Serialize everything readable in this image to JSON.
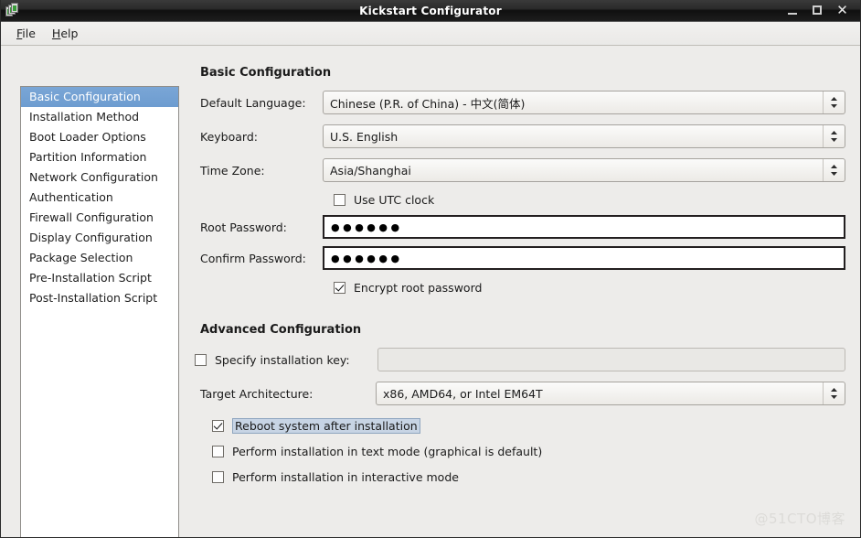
{
  "window": {
    "title": "Kickstart Configurator",
    "icon": "kickstart-app-icon",
    "minimize_label": "—",
    "maximize_label": "□",
    "close_label": "✕"
  },
  "menubar": {
    "items": [
      {
        "label": "File",
        "mnemonic": "F",
        "rest": "ile"
      },
      {
        "label": "Help",
        "mnemonic": "H",
        "rest": "elp"
      }
    ]
  },
  "sidebar": {
    "items": [
      {
        "label": "Basic Configuration",
        "selected": true
      },
      {
        "label": "Installation Method",
        "selected": false
      },
      {
        "label": "Boot Loader Options",
        "selected": false
      },
      {
        "label": "Partition Information",
        "selected": false
      },
      {
        "label": "Network Configuration",
        "selected": false
      },
      {
        "label": "Authentication",
        "selected": false
      },
      {
        "label": "Firewall Configuration",
        "selected": false
      },
      {
        "label": "Display Configuration",
        "selected": false
      },
      {
        "label": "Package Selection",
        "selected": false
      },
      {
        "label": "Pre-Installation Script",
        "selected": false
      },
      {
        "label": "Post-Installation Script",
        "selected": false
      }
    ]
  },
  "basic": {
    "heading": "Basic Configuration",
    "default_language_label": "Default Language:",
    "default_language_value": "Chinese (P.R. of China) - 中文(简体)",
    "keyboard_label": "Keyboard:",
    "keyboard_value": "U.S. English",
    "time_zone_label": "Time Zone:",
    "time_zone_value": "Asia/Shanghai",
    "use_utc_label": "Use UTC clock",
    "use_utc_checked": false,
    "root_password_label": "Root Password:",
    "root_password_value": "●●●●●●",
    "confirm_password_label": "Confirm Password:",
    "confirm_password_value": "●●●●●●",
    "encrypt_label": "Encrypt root password",
    "encrypt_checked": true
  },
  "advanced": {
    "heading": "Advanced Configuration",
    "specify_key_label": "Specify installation key:",
    "specify_key_checked": false,
    "installation_key_value": "",
    "installation_key_disabled": true,
    "target_arch_label": "Target Architecture:",
    "target_arch_value": "x86, AMD64, or Intel EM64T",
    "reboot_label": "Reboot system after installation",
    "reboot_checked": true,
    "reboot_focused": true,
    "text_mode_label": "Perform installation in text mode (graphical is default)",
    "text_mode_checked": false,
    "interactive_label": "Perform installation in interactive mode",
    "interactive_checked": false
  },
  "watermark": {
    "text": "@51CTO博客"
  },
  "colors": {
    "selection_blue": "#6d9cd0",
    "window_bg": "#edecea",
    "titlebar_dark": "#1d1d1d",
    "focus_highlight": "#c7d4e4"
  }
}
